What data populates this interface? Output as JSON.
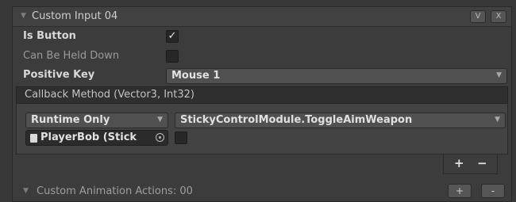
{
  "header": {
    "title": "Custom Input 04",
    "btn_v": "V",
    "btn_x": "X"
  },
  "fields": {
    "is_button_label": "Is Button",
    "is_button_checked": true,
    "is_button_check_glyph": "✓",
    "can_be_held_label": "Can Be Held Down",
    "can_be_held_checked": false,
    "positive_key_label": "Positive Key",
    "positive_key_value": "Mouse 1"
  },
  "callback": {
    "header": "Callback Method (Vector3, Int32)",
    "mode": "Runtime Only",
    "function": "StickyControlModule.ToggleAimWeapon",
    "target_object": "PlayerBob (Stick",
    "arg_checked": false,
    "add": "+",
    "remove": "−"
  },
  "footer": {
    "label": "Custom Animation Actions: 00",
    "add": "+",
    "remove": "-"
  },
  "icons": {
    "foldout": "▼",
    "dropdown": "▼"
  }
}
